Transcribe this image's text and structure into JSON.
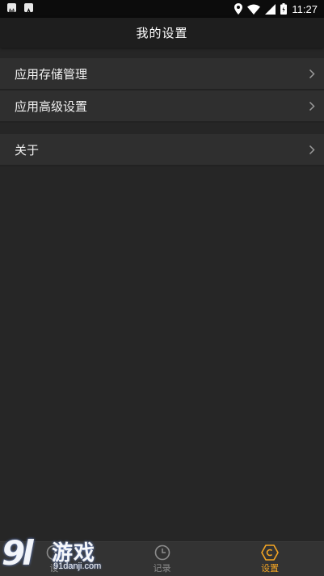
{
  "status_bar": {
    "time": "11:27"
  },
  "header": {
    "title": "我的设置"
  },
  "settings": {
    "group1": [
      {
        "label": "应用存储管理"
      },
      {
        "label": "应用高级设置"
      }
    ],
    "group2": [
      {
        "label": "关于"
      }
    ]
  },
  "bottom_nav": {
    "items": [
      {
        "label": "设",
        "icon": "gauge-icon",
        "active": false
      },
      {
        "label": "记录",
        "icon": "clock-icon",
        "active": false
      },
      {
        "label": "设置",
        "icon": "gear-icon",
        "active": true
      }
    ]
  },
  "watermark": {
    "logo": "9l",
    "name": "游戏",
    "url": "91danji.com"
  },
  "colors": {
    "background": "#262626",
    "row": "#2f2f2f",
    "accent": "#f5a623",
    "inactive": "#8c8c8c"
  }
}
